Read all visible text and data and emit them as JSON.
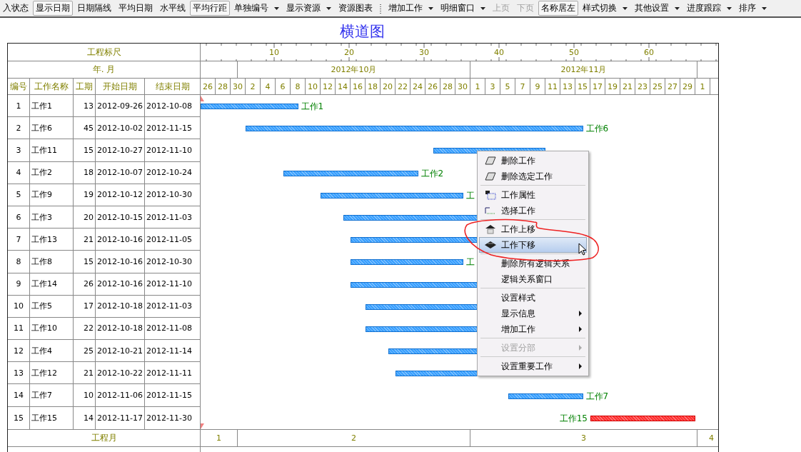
{
  "toolbar": [
    {
      "label": "入状态",
      "kind": "button",
      "disabled": false
    },
    {
      "label": "显示日期",
      "kind": "boxed",
      "disabled": false
    },
    {
      "label": "日期隔线",
      "kind": "button",
      "disabled": false
    },
    {
      "label": "平均日期",
      "kind": "button",
      "disabled": false
    },
    {
      "label": "水平线",
      "kind": "button",
      "disabled": false
    },
    {
      "label": "平均行距",
      "kind": "boxed",
      "disabled": false
    },
    {
      "label": "单独编号",
      "kind": "dropdown",
      "disabled": false
    },
    {
      "label": "显示资源",
      "kind": "dropdown",
      "disabled": false
    },
    {
      "label": "资源图表",
      "kind": "button",
      "disabled": false
    },
    {
      "kind": "grip"
    },
    {
      "label": "增加工作",
      "kind": "dropdown",
      "disabled": false
    },
    {
      "label": "明细窗口",
      "kind": "dropdown",
      "disabled": false
    },
    {
      "label": "上页",
      "kind": "button",
      "disabled": true
    },
    {
      "label": "下页",
      "kind": "button",
      "disabled": true
    },
    {
      "label": "名称居左",
      "kind": "boxed",
      "disabled": false
    },
    {
      "label": "样式切换",
      "kind": "dropdown",
      "disabled": false
    },
    {
      "label": "其他设置",
      "kind": "dropdown",
      "disabled": false
    },
    {
      "label": "进度跟踪",
      "kind": "dropdown",
      "disabled": false
    },
    {
      "label": "排序",
      "kind": "dropdown",
      "disabled": false
    }
  ],
  "title": "横道图",
  "header": {
    "ruler_label": "工程标尺",
    "month_label": "年. 月",
    "columns": [
      "编号",
      "工作名称",
      "工期",
      "开始日期",
      "结束日期"
    ]
  },
  "ruler": {
    "labels": [
      "10",
      "20",
      "30",
      "40",
      "50",
      "60"
    ]
  },
  "months": [
    "2012年10月",
    "2012年11月"
  ],
  "dates": [
    "26",
    "28",
    "30",
    "2",
    "4",
    "6",
    "8",
    "10",
    "12",
    "14",
    "16",
    "18",
    "20",
    "22",
    "24",
    "26",
    "28",
    "30",
    "1",
    "3",
    "5",
    "7",
    "9",
    "11",
    "13",
    "15",
    "17",
    "19",
    "21",
    "23",
    "25",
    "27",
    "29",
    "1"
  ],
  "rows": [
    {
      "no": "1",
      "name": "工作1",
      "duration": "13",
      "start": "2012-09-26",
      "end": "2012-10-08",
      "critical": false,
      "bar_label": "工作1"
    },
    {
      "no": "2",
      "name": "工作6",
      "duration": "45",
      "start": "2012-10-02",
      "end": "2012-11-15",
      "critical": false,
      "bar_label": "工作6"
    },
    {
      "no": "3",
      "name": "工作11",
      "duration": "15",
      "start": "2012-10-27",
      "end": "2012-11-10",
      "critical": false
    },
    {
      "no": "4",
      "name": "工作2",
      "duration": "18",
      "start": "2012-10-07",
      "end": "2012-10-24",
      "critical": false,
      "bar_label": "工作2"
    },
    {
      "no": "5",
      "name": "工作9",
      "duration": "19",
      "start": "2012-10-12",
      "end": "2012-10-30",
      "critical": false,
      "bar_label": "工"
    },
    {
      "no": "6",
      "name": "工作3",
      "duration": "20",
      "start": "2012-10-15",
      "end": "2012-11-03",
      "critical": false
    },
    {
      "no": "7",
      "name": "工作13",
      "duration": "21",
      "start": "2012-10-16",
      "end": "2012-11-05",
      "critical": false
    },
    {
      "no": "8",
      "name": "工作8",
      "duration": "15",
      "start": "2012-10-16",
      "end": "2012-10-30",
      "critical": false,
      "bar_label": "工"
    },
    {
      "no": "9",
      "name": "工作14",
      "duration": "26",
      "start": "2012-10-16",
      "end": "2012-11-10",
      "critical": false
    },
    {
      "no": "10",
      "name": "工作5",
      "duration": "17",
      "start": "2012-10-18",
      "end": "2012-11-03",
      "critical": false
    },
    {
      "no": "11",
      "name": "工作10",
      "duration": "22",
      "start": "2012-10-18",
      "end": "2012-11-08",
      "critical": false
    },
    {
      "no": "12",
      "name": "工作4",
      "duration": "25",
      "start": "2012-10-21",
      "end": "2012-11-14",
      "critical": false
    },
    {
      "no": "13",
      "name": "工作12",
      "duration": "21",
      "start": "2012-10-22",
      "end": "2012-11-11",
      "critical": false
    },
    {
      "no": "14",
      "name": "工作7",
      "duration": "10",
      "start": "2012-11-06",
      "end": "2012-11-15",
      "critical": false,
      "bar_label": "工作7"
    },
    {
      "no": "15",
      "name": "工作15",
      "duration": "14",
      "start": "2012-11-17",
      "end": "2012-11-30",
      "critical": true,
      "bar_label": "工作15"
    }
  ],
  "footer": {
    "month_label": "工程月",
    "months": [
      "1",
      "2",
      "3",
      "4"
    ]
  },
  "context_menu": {
    "groups": [
      [
        {
          "label": "删除工作",
          "disabled": false,
          "submenu": false,
          "selected": false
        },
        {
          "label": "删除选定工作",
          "disabled": false,
          "submenu": false,
          "selected": false
        }
      ],
      [
        {
          "label": "工作属性",
          "disabled": false,
          "submenu": false,
          "selected": false
        },
        {
          "label": "选择工作",
          "disabled": false,
          "submenu": false,
          "selected": false
        }
      ],
      [
        {
          "label": "工作上移",
          "disabled": false,
          "submenu": false,
          "selected": false
        },
        {
          "label": "工作下移",
          "disabled": false,
          "submenu": false,
          "selected": true
        }
      ],
      [
        {
          "label": "删除所有逻辑关系",
          "disabled": false,
          "submenu": false,
          "selected": false
        },
        {
          "label": "逻辑关系窗口",
          "disabled": false,
          "submenu": false,
          "selected": false
        }
      ],
      [
        {
          "label": "设置样式",
          "disabled": false,
          "submenu": false,
          "selected": false
        },
        {
          "label": "显示信息",
          "disabled": false,
          "submenu": true,
          "selected": false
        },
        {
          "label": "增加工作",
          "disabled": false,
          "submenu": true,
          "selected": false
        }
      ],
      [
        {
          "label": "设置分部",
          "disabled": true,
          "submenu": true,
          "selected": false
        }
      ],
      [
        {
          "label": "设置重要工作",
          "disabled": false,
          "submenu": true,
          "selected": false
        }
      ]
    ]
  }
}
